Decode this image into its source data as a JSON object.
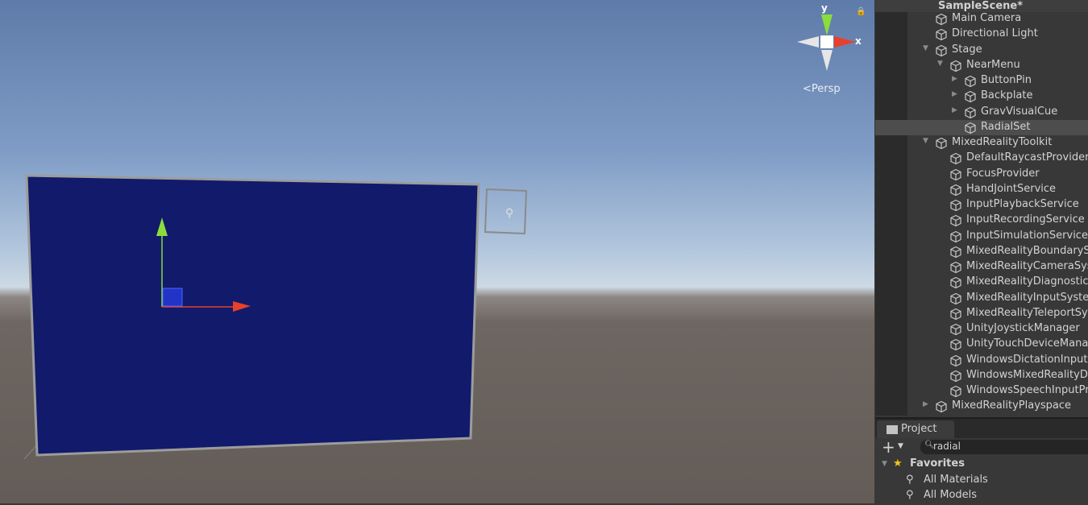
{
  "scene_view": {
    "projection_label": "Persp",
    "gizmo_axes": {
      "y": "y",
      "x": "x"
    },
    "quad_color": "#111a6b",
    "colors": {
      "x_axis": "#e8402a",
      "y_axis": "#8bdd3b",
      "z_axis": "#3b5ee8"
    },
    "pin_icon": "pin-icon"
  },
  "hierarchy": {
    "scene_name": "SampleScene*",
    "items": [
      {
        "label": "Main Camera",
        "level": 0,
        "arrow": ""
      },
      {
        "label": "Directional Light",
        "level": 0,
        "arrow": ""
      },
      {
        "label": "Stage",
        "level": 0,
        "arrow": "▼"
      },
      {
        "label": "NearMenu",
        "level": 1,
        "arrow": "▼"
      },
      {
        "label": "ButtonPin",
        "level": 2,
        "arrow": "▶"
      },
      {
        "label": "Backplate",
        "level": 2,
        "arrow": "▶"
      },
      {
        "label": "GravVisualCue",
        "level": 2,
        "arrow": "▶"
      },
      {
        "label": "RadialSet",
        "level": 2,
        "arrow": "",
        "selected": true
      },
      {
        "label": "MixedRealityToolkit",
        "level": 0,
        "arrow": "▼"
      },
      {
        "label": "DefaultRaycastProvider",
        "level": 1,
        "arrow": ""
      },
      {
        "label": "FocusProvider",
        "level": 1,
        "arrow": ""
      },
      {
        "label": "HandJointService",
        "level": 1,
        "arrow": ""
      },
      {
        "label": "InputPlaybackService",
        "level": 1,
        "arrow": ""
      },
      {
        "label": "InputRecordingService",
        "level": 1,
        "arrow": ""
      },
      {
        "label": "InputSimulationService",
        "level": 1,
        "arrow": ""
      },
      {
        "label": "MixedRealityBoundarySystem",
        "level": 1,
        "arrow": ""
      },
      {
        "label": "MixedRealityCameraSystem",
        "level": 1,
        "arrow": ""
      },
      {
        "label": "MixedRealityDiagnosticsSystem",
        "level": 1,
        "arrow": ""
      },
      {
        "label": "MixedRealityInputSystem",
        "level": 1,
        "arrow": ""
      },
      {
        "label": "MixedRealityTeleportSystem",
        "level": 1,
        "arrow": ""
      },
      {
        "label": "UnityJoystickManager",
        "level": 1,
        "arrow": ""
      },
      {
        "label": "UnityTouchDeviceManager",
        "level": 1,
        "arrow": ""
      },
      {
        "label": "WindowsDictationInputProvider",
        "level": 1,
        "arrow": ""
      },
      {
        "label": "WindowsMixedRealityDeviceManager",
        "level": 1,
        "arrow": ""
      },
      {
        "label": "WindowsSpeechInputProvider",
        "level": 1,
        "arrow": ""
      },
      {
        "label": "MixedRealityPlayspace",
        "level": 0,
        "arrow": "▶"
      }
    ]
  },
  "project": {
    "tab_label": "Project",
    "search_value": "radial",
    "favorites_label": "Favorites",
    "favorites": [
      "All Materials",
      "All Models"
    ]
  }
}
